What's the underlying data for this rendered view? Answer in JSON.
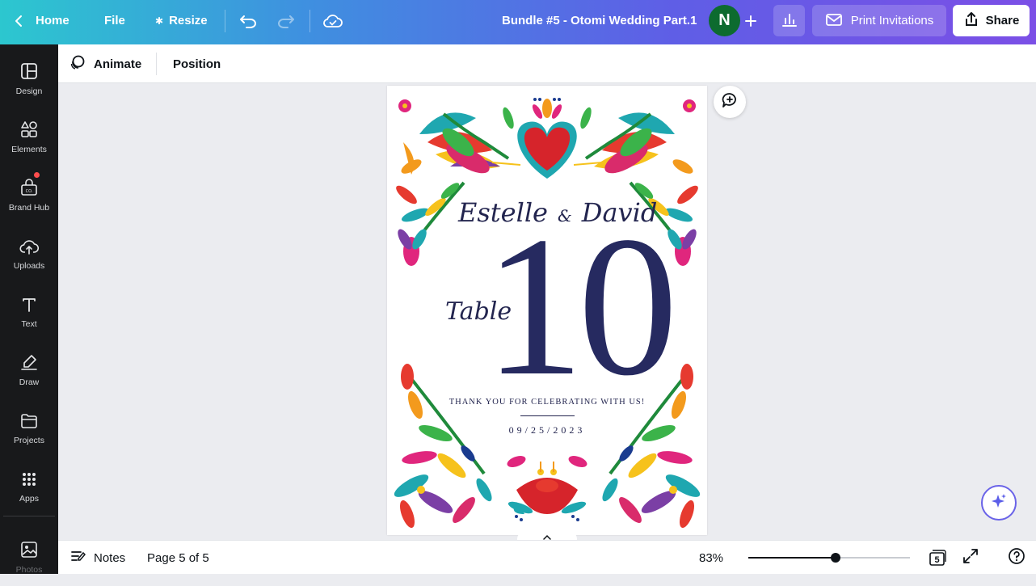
{
  "header": {
    "home_label": "Home",
    "file_label": "File",
    "resize_label": "Resize",
    "doc_title": "Bundle #5 - Otomi Wedding Part.1",
    "avatar_initial": "N",
    "print_label": "Print Invitations",
    "share_label": "Share"
  },
  "sidebar": {
    "items": [
      {
        "label": "Design",
        "icon": "design-icon"
      },
      {
        "label": "Elements",
        "icon": "elements-icon"
      },
      {
        "label": "Brand Hub",
        "icon": "brand-hub-icon"
      },
      {
        "label": "Uploads",
        "icon": "uploads-icon"
      },
      {
        "label": "Text",
        "icon": "text-icon"
      },
      {
        "label": "Draw",
        "icon": "draw-icon"
      },
      {
        "label": "Projects",
        "icon": "projects-icon"
      },
      {
        "label": "Apps",
        "icon": "apps-icon"
      },
      {
        "label": "Photos",
        "icon": "photos-icon"
      }
    ]
  },
  "context_toolbar": {
    "animate_label": "Animate",
    "position_label": "Position"
  },
  "design": {
    "name_left": "Estelle",
    "ampersand": "&",
    "name_right": "David",
    "table_word": "Table",
    "table_number": "10",
    "thanks_text": "THANK YOU FOR CELEBRATING WITH US!",
    "date": "09/25/2023"
  },
  "footer": {
    "notes_label": "Notes",
    "page_indicator": "Page 5 of 5",
    "zoom_label": "83%",
    "zoom_level": 0.54,
    "page_count_badge": "5"
  },
  "colors": {
    "header_gradient": [
      "#2cc7cf",
      "#5f5ee6",
      "#7b4fe6"
    ],
    "sidebar_bg": "#18191b",
    "navy_text": "#262a60",
    "avatar_bg": "#0d6b2f"
  }
}
